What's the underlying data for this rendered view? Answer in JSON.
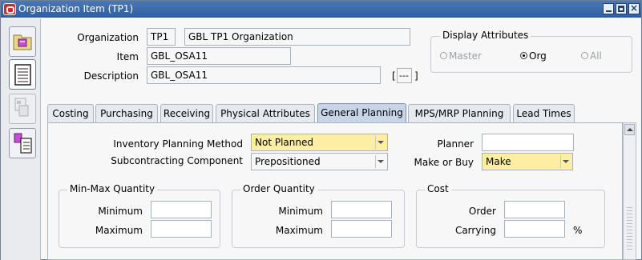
{
  "window": {
    "title": "Organization Item (TP1)"
  },
  "header": {
    "organization_label": "Organization",
    "organization_code": "TP1",
    "organization_name": "GBL TP1 Organization",
    "item_label": "Item",
    "item_value": "GBL_OSA11",
    "description_label": "Description",
    "description_value": "GBL_OSA11",
    "dff_open": "[",
    "dff_value": "---",
    "dff_close": "]"
  },
  "display_attributes": {
    "title": "Display Attributes",
    "options": [
      {
        "label": "Master",
        "selected": false
      },
      {
        "label": "Org",
        "selected": true
      },
      {
        "label": "All",
        "selected": false
      }
    ]
  },
  "tabs": [
    {
      "label": "Costing"
    },
    {
      "label": "Purchasing"
    },
    {
      "label": "Receiving"
    },
    {
      "label": "Physical Attributes"
    },
    {
      "label": "General Planning",
      "active": true
    },
    {
      "label": "MPS/MRP Planning"
    },
    {
      "label": "Lead Times"
    }
  ],
  "general_planning": {
    "inventory_planning_method_label": "Inventory Planning Method",
    "inventory_planning_method_value": "Not Planned",
    "subcontracting_component_label": "Subcontracting Component",
    "subcontracting_component_value": "Prepositioned",
    "planner_label": "Planner",
    "planner_value": "",
    "make_or_buy_label": "Make or Buy",
    "make_or_buy_value": "Make",
    "min_max": {
      "title": "Min-Max Quantity",
      "minimum_label": "Minimum",
      "maximum_label": "Maximum",
      "minimum_value": "",
      "maximum_value": ""
    },
    "order_quantity": {
      "title": "Order Quantity",
      "minimum_label": "Minimum",
      "maximum_label": "Maximum",
      "minimum_value": "",
      "maximum_value": ""
    },
    "cost": {
      "title": "Cost",
      "order_label": "Order",
      "carrying_label": "Carrying",
      "order_value": "",
      "carrying_value": "",
      "percent": "%"
    }
  },
  "colors": {
    "titlebar": "#2f5e9e",
    "required_field": "#fcefa1",
    "active_tab": "#c8d5e8"
  },
  "icons": [
    "organization-icon",
    "item-list-icon",
    "item-attributes-icon",
    "item-categories-icon"
  ]
}
